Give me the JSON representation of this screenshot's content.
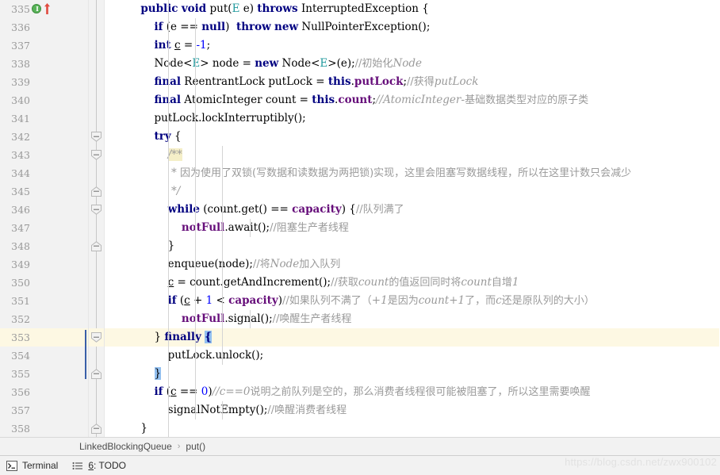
{
  "window": {
    "watermark": "https://blog.csdn.net/zwx900102"
  },
  "breadcrumb": {
    "class_name": "LinkedBlockingQueue",
    "separator": "›",
    "method_name": "put()"
  },
  "statusbar": {
    "items": [
      {
        "icon": "terminal-icon",
        "label": "Terminal"
      },
      {
        "icon": "todo-list-icon",
        "number": "6",
        "label": ": TODO"
      }
    ]
  },
  "gutter": {
    "markers": {
      "line_335": {
        "implemented_icon": "green-implements-circle",
        "glyph": "I",
        "arrow_icon": "red-up-arrow"
      }
    }
  },
  "editor": {
    "highlighted_line": 353,
    "colors": {
      "keyword": "#000080",
      "field": "#660e7a",
      "number": "#0000ff",
      "comment": "#9a9a9a",
      "type_param": "#20999d",
      "caret_line_bg": "#fdf8e3",
      "brace_match_bg": "#93c0f0",
      "gutter_bg": "#f2f2f2"
    },
    "lines": [
      {
        "num": "335",
        "fold": "none",
        "tokens": [
          {
            "t": "        ",
            "c": "plain"
          },
          {
            "t": "public",
            "c": "kw"
          },
          {
            "t": " ",
            "c": "plain"
          },
          {
            "t": "void",
            "c": "kw"
          },
          {
            "t": " put(",
            "c": "plain"
          },
          {
            "t": "E",
            "c": "typ"
          },
          {
            "t": " e) ",
            "c": "plain"
          },
          {
            "t": "throws",
            "c": "kw"
          },
          {
            "t": " InterruptedException {",
            "c": "plain"
          }
        ]
      },
      {
        "num": "336",
        "fold": "none",
        "tokens": [
          {
            "t": "            ",
            "c": "plain"
          },
          {
            "t": "if",
            "c": "kw"
          },
          {
            "t": " (e == ",
            "c": "plain"
          },
          {
            "t": "null",
            "c": "kw"
          },
          {
            "t": ")  ",
            "c": "plain"
          },
          {
            "t": "throw",
            "c": "kw"
          },
          {
            "t": " ",
            "c": "plain"
          },
          {
            "t": "new",
            "c": "kw"
          },
          {
            "t": " NullPointerException();",
            "c": "plain"
          }
        ]
      },
      {
        "num": "337",
        "fold": "none",
        "tokens": [
          {
            "t": "            ",
            "c": "plain"
          },
          {
            "t": "int",
            "c": "kw"
          },
          {
            "t": " ",
            "c": "plain"
          },
          {
            "t": "c",
            "c": "loc"
          },
          {
            "t": " = ",
            "c": "plain"
          },
          {
            "t": "-1",
            "c": "num"
          },
          {
            "t": ";",
            "c": "plain"
          }
        ]
      },
      {
        "num": "338",
        "fold": "none",
        "tokens": [
          {
            "t": "            Node<",
            "c": "plain"
          },
          {
            "t": "E",
            "c": "typ"
          },
          {
            "t": "> node = ",
            "c": "plain"
          },
          {
            "t": "new",
            "c": "kw"
          },
          {
            "t": " Node<",
            "c": "plain"
          },
          {
            "t": "E",
            "c": "typ"
          },
          {
            "t": ">(e);",
            "c": "plain"
          },
          {
            "t": "//初始化",
            "c": "cmt-cn"
          },
          {
            "t": "Node",
            "c": "cmt"
          }
        ]
      },
      {
        "num": "339",
        "fold": "none",
        "tokens": [
          {
            "t": "            ",
            "c": "plain"
          },
          {
            "t": "final",
            "c": "kw"
          },
          {
            "t": " ReentrantLock putLock = ",
            "c": "plain"
          },
          {
            "t": "this",
            "c": "kw"
          },
          {
            "t": ".",
            "c": "plain"
          },
          {
            "t": "putLock",
            "c": "fld"
          },
          {
            "t": ";",
            "c": "plain"
          },
          {
            "t": "//获得",
            "c": "cmt-cn"
          },
          {
            "t": "putLock",
            "c": "cmt"
          }
        ]
      },
      {
        "num": "340",
        "fold": "none",
        "tokens": [
          {
            "t": "            ",
            "c": "plain"
          },
          {
            "t": "final",
            "c": "kw"
          },
          {
            "t": " AtomicInteger count = ",
            "c": "plain"
          },
          {
            "t": "this",
            "c": "kw"
          },
          {
            "t": ".",
            "c": "plain"
          },
          {
            "t": "count",
            "c": "fld"
          },
          {
            "t": ";",
            "c": "plain"
          },
          {
            "t": "//AtomicInteger",
            "c": "cmt"
          },
          {
            "t": "-基础数据类型对应的原子类",
            "c": "cmt-cn"
          }
        ]
      },
      {
        "num": "341",
        "fold": "none",
        "tokens": [
          {
            "t": "            putLock.lockInterruptibly();",
            "c": "plain"
          }
        ]
      },
      {
        "num": "342",
        "fold": "start",
        "tokens": [
          {
            "t": "            ",
            "c": "plain"
          },
          {
            "t": "try",
            "c": "kw"
          },
          {
            "t": " {",
            "c": "plain"
          }
        ]
      },
      {
        "num": "343",
        "fold": "start",
        "tokens": [
          {
            "t": "                ",
            "c": "plain"
          },
          {
            "t": "/**",
            "c": "cmt doc-hl"
          }
        ]
      },
      {
        "num": "344",
        "fold": "none",
        "tokens": [
          {
            "t": "                 ",
            "c": "plain"
          },
          {
            "t": "* ",
            "c": "cmt"
          },
          {
            "t": "因为使用了双锁(写数据和读数据为两把锁)实现，这里会阻塞写数据线程，所以在这里计数只会减少",
            "c": "cmt-cn"
          }
        ]
      },
      {
        "num": "345",
        "fold": "end",
        "tokens": [
          {
            "t": "                 ",
            "c": "plain"
          },
          {
            "t": "*/",
            "c": "cmt"
          }
        ]
      },
      {
        "num": "346",
        "fold": "start",
        "tokens": [
          {
            "t": "                ",
            "c": "plain"
          },
          {
            "t": "while",
            "c": "kw"
          },
          {
            "t": " (count.get() == ",
            "c": "plain"
          },
          {
            "t": "capacity",
            "c": "fld"
          },
          {
            "t": ") {",
            "c": "plain"
          },
          {
            "t": "//队列满了",
            "c": "cmt-cn"
          }
        ]
      },
      {
        "num": "347",
        "fold": "none",
        "tokens": [
          {
            "t": "                    ",
            "c": "plain"
          },
          {
            "t": "notFull",
            "c": "fld"
          },
          {
            "t": ".await();",
            "c": "plain"
          },
          {
            "t": "//阻塞生产者线程",
            "c": "cmt-cn"
          }
        ]
      },
      {
        "num": "348",
        "fold": "end",
        "tokens": [
          {
            "t": "                }",
            "c": "plain"
          }
        ]
      },
      {
        "num": "349",
        "fold": "none",
        "tokens": [
          {
            "t": "                enqueue(node);",
            "c": "plain"
          },
          {
            "t": "//将",
            "c": "cmt-cn"
          },
          {
            "t": "Node",
            "c": "cmt"
          },
          {
            "t": "加入队列",
            "c": "cmt-cn"
          }
        ]
      },
      {
        "num": "350",
        "fold": "none",
        "tokens": [
          {
            "t": "                ",
            "c": "plain"
          },
          {
            "t": "c",
            "c": "loc"
          },
          {
            "t": " = count.getAndIncrement();",
            "c": "plain"
          },
          {
            "t": "//获取",
            "c": "cmt-cn"
          },
          {
            "t": "count",
            "c": "cmt"
          },
          {
            "t": "的值返回同时将",
            "c": "cmt-cn"
          },
          {
            "t": "count",
            "c": "cmt"
          },
          {
            "t": "自增",
            "c": "cmt-cn"
          },
          {
            "t": "1",
            "c": "cmt"
          }
        ]
      },
      {
        "num": "351",
        "fold": "none",
        "tokens": [
          {
            "t": "                ",
            "c": "plain"
          },
          {
            "t": "if",
            "c": "kw"
          },
          {
            "t": " (",
            "c": "plain"
          },
          {
            "t": "c",
            "c": "loc"
          },
          {
            "t": " + ",
            "c": "plain"
          },
          {
            "t": "1",
            "c": "num"
          },
          {
            "t": " < ",
            "c": "plain"
          },
          {
            "t": "capacity",
            "c": "fld"
          },
          {
            "t": ")",
            "c": "plain"
          },
          {
            "t": "//如果队列不满了（",
            "c": "cmt-cn"
          },
          {
            "t": "+1",
            "c": "cmt"
          },
          {
            "t": "是因为",
            "c": "cmt-cn"
          },
          {
            "t": "count+1",
            "c": "cmt"
          },
          {
            "t": "了，而",
            "c": "cmt-cn"
          },
          {
            "t": "c",
            "c": "cmt"
          },
          {
            "t": "还是原队列的大小）",
            "c": "cmt-cn"
          }
        ]
      },
      {
        "num": "352",
        "fold": "none",
        "tokens": [
          {
            "t": "                    ",
            "c": "plain"
          },
          {
            "t": "notFull",
            "c": "fld"
          },
          {
            "t": ".signal();",
            "c": "plain"
          },
          {
            "t": "//唤醒生产者线程",
            "c": "cmt-cn"
          }
        ]
      },
      {
        "num": "353",
        "fold": "start",
        "highlight": true,
        "tokens": [
          {
            "t": "            } ",
            "c": "plain"
          },
          {
            "t": "finally",
            "c": "kw"
          },
          {
            "t": " ",
            "c": "plain"
          },
          {
            "t": "{",
            "c": "kw brace-hl"
          }
        ]
      },
      {
        "num": "354",
        "fold": "none",
        "tokens": [
          {
            "t": "                putLock.unlock();",
            "c": "plain"
          }
        ]
      },
      {
        "num": "355",
        "fold": "end",
        "tokens": [
          {
            "t": "            ",
            "c": "plain"
          },
          {
            "t": "}",
            "c": "plain brace-hl"
          }
        ]
      },
      {
        "num": "356",
        "fold": "none",
        "tokens": [
          {
            "t": "            ",
            "c": "plain"
          },
          {
            "t": "if",
            "c": "kw"
          },
          {
            "t": " (",
            "c": "plain"
          },
          {
            "t": "c",
            "c": "loc"
          },
          {
            "t": " == ",
            "c": "plain"
          },
          {
            "t": "0",
            "c": "num"
          },
          {
            "t": ")",
            "c": "plain"
          },
          {
            "t": "//c==0",
            "c": "cmt"
          },
          {
            "t": "说明之前队列是空的，那么消费者线程很可能被阻塞了，所以这里需要唤醒",
            "c": "cmt-cn"
          }
        ]
      },
      {
        "num": "357",
        "fold": "none",
        "tokens": [
          {
            "t": "                signalNotEmpty();",
            "c": "plain"
          },
          {
            "t": "//唤醒消费者线程",
            "c": "cmt-cn"
          }
        ]
      },
      {
        "num": "358",
        "fold": "end",
        "tokens": [
          {
            "t": "        }",
            "c": "plain"
          }
        ]
      }
    ]
  }
}
